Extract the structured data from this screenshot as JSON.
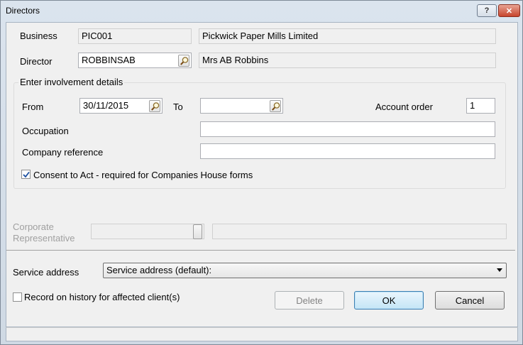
{
  "window": {
    "title": "Directors",
    "help_label": "?",
    "close_label": "✕"
  },
  "business": {
    "label": "Business",
    "code": "PIC001",
    "name": "Pickwick Paper Mills Limited"
  },
  "director": {
    "label": "Director",
    "code": "ROBBINSAB",
    "name": "Mrs AB Robbins"
  },
  "involvement": {
    "group_title": "Enter involvement details",
    "from_label": "From",
    "from_value": "30/11/2015",
    "to_label": "To",
    "to_value": "",
    "account_order_label": "Account order",
    "account_order_value": "1",
    "occupation_label": "Occupation",
    "occupation_value": "",
    "company_reference_label": "Company reference",
    "company_reference_value": "",
    "consent_label": "Consent to Act - required for Companies House forms",
    "consent_checked": true
  },
  "corporate_representative": {
    "label_line1": "Corporate",
    "label_line2": "Representative",
    "value": ""
  },
  "service_address": {
    "label": "Service address",
    "selected": "Service address (default):"
  },
  "record_history": {
    "label": "Record on history for affected client(s)",
    "checked": false
  },
  "buttons": {
    "delete": "Delete",
    "ok": "OK",
    "cancel": "Cancel"
  }
}
